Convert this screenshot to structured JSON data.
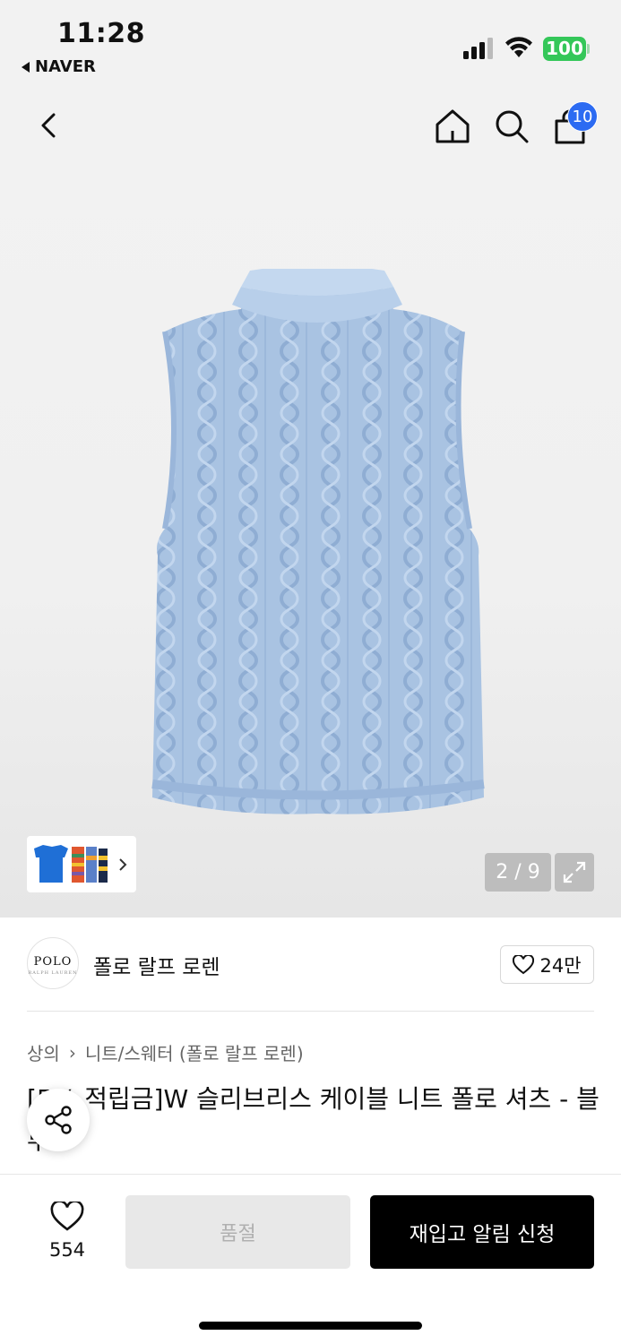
{
  "status_bar": {
    "time": "11:28",
    "back_app": "NAVER",
    "battery": "100",
    "colors": {
      "battery": "#34c759"
    }
  },
  "nav": {
    "icons": [
      "back-icon",
      "home-icon",
      "search-icon",
      "cart-icon"
    ],
    "cart_badge": "10",
    "colors": {
      "badge": "#2c6bf2"
    }
  },
  "gallery": {
    "counter": "2 / 9",
    "current_page": 2,
    "total_pages": 9
  },
  "brand": {
    "logo_text": "POLO",
    "logo_subtext": "RALPH LAUREN",
    "name": "폴로 랄프 로렌",
    "likes": "24만"
  },
  "breadcrumb": {
    "category": "상의",
    "subcategory": "니트/스웨터 (폴로 랄프 로렌)"
  },
  "product": {
    "title": "[5% 적립금]W 슬리브리스 케이블 니트 폴로 셔츠 - 블루"
  },
  "actions": {
    "wish_count": "554",
    "soldout_label": "품절",
    "restock_label": "재입고 알림 신청"
  }
}
